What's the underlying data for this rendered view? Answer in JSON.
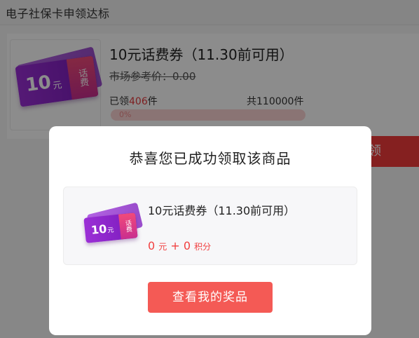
{
  "topbar": {
    "title": "电子社保卡申领达标"
  },
  "product": {
    "title": "10元话费券（11.30前可用）",
    "market_price": "市场参考价：0.00",
    "claimed_prefix": "已领",
    "claimed_count": "406",
    "claimed_suffix": "件",
    "total": "共110000件",
    "progress_label": "0%",
    "progress_value": 0,
    "claim_button": "领"
  },
  "ticket": {
    "amount": "10",
    "unit": "元",
    "kind": "话费"
  },
  "dialog": {
    "title": "恭喜您已成功领取该商品",
    "prize_name": "10元话费券（11.30前可用）",
    "cost_yuan": "0",
    "yuan_unit": "元",
    "plus": "+",
    "cost_points": "0",
    "points_unit": "积分",
    "view_button": "查看我的奖品"
  },
  "colors": {
    "accent": "#f45a55",
    "price_red": "#e4393c",
    "ticket_purple": "#8a2ac8"
  }
}
